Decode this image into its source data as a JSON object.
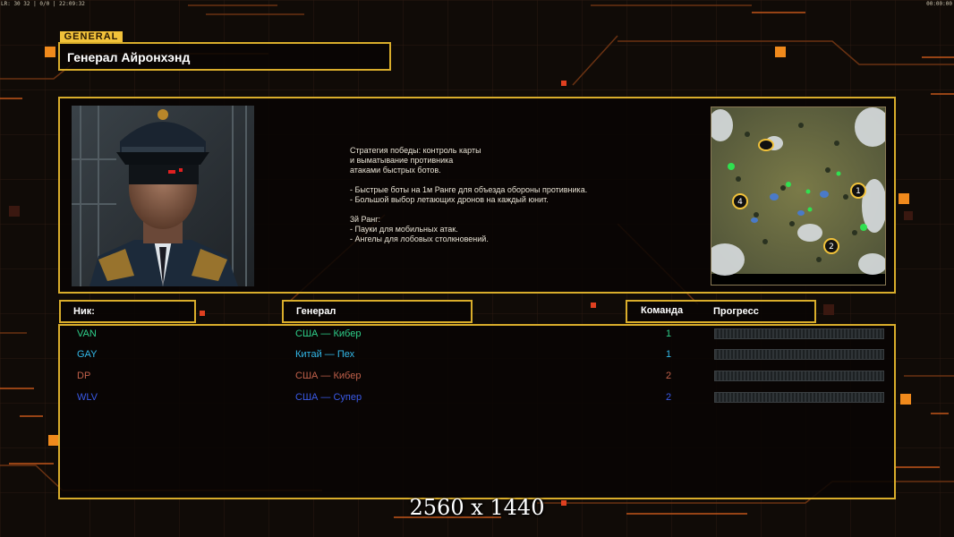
{
  "top_status": {
    "left": "LR: 30 32 | 0/0 | 22:09:32",
    "right": "00:00:00"
  },
  "general": {
    "tag": "GENERAL",
    "name": "Генерал Айронхэнд"
  },
  "description": [
    "Стратегия победы: контроль карты",
    "и выматывание противника",
    "атаками быстрых ботов.",
    "",
    "- Быстрые боты на 1м Ранге для объезда обороны противника.",
    "- Большой выбор летающих дронов на каждый юнит.",
    "",
    "3й Ранг:",
    "- Пауки для мобильных атак.",
    "- Ангелы для лобовых столкновений."
  ],
  "minimap": {
    "start_positions": [
      "1",
      "2",
      "4"
    ]
  },
  "headers": {
    "nick": "Ник:",
    "general": "Генерал",
    "team": "Команда",
    "progress": "Прогресс"
  },
  "players": [
    {
      "nick": "VAN",
      "general": "США — Кибер",
      "team": "1",
      "color": "#2ecf8a",
      "progress": 0
    },
    {
      "nick": "GAY",
      "general": "Китай — Пех",
      "team": "1",
      "color": "#32b8e8",
      "progress": 0
    },
    {
      "nick": "DP",
      "general": "США — Кибер",
      "team": "2",
      "color": "#c0604a",
      "progress": 0
    },
    {
      "nick": "WLV",
      "general": "США — Супер",
      "team": "2",
      "color": "#3a5ae8",
      "progress": 0
    }
  ],
  "resolution_label": "2560 x 1440",
  "colors": {
    "frame": "#d9ad2b",
    "accent_orange": "#f08a1c",
    "background": "#100b07"
  }
}
